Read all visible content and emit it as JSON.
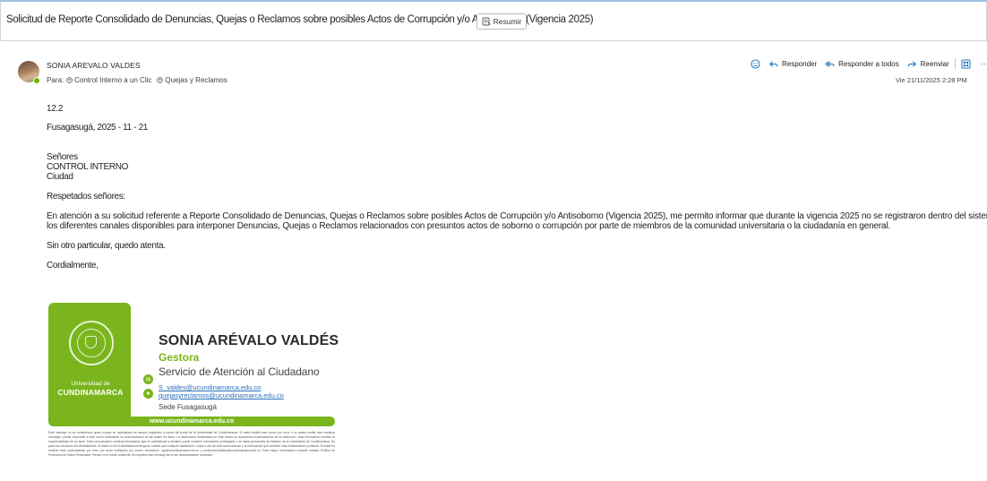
{
  "subject": "Solicitud de Reporte Consolidado de Denuncias, Quejas o Reclamos sobre posibles Actos de Corrupción y/o Antisoborno (Vigencia 2025)",
  "summarize_label": "Resumir",
  "sender": {
    "name": "SONIA AREVALO VALDES",
    "presence": "available"
  },
  "recipients": {
    "label": "Para:",
    "items": [
      "Control Interno a un Clic",
      "Quejas y Reclamos"
    ]
  },
  "actions": {
    "reply": "Responder",
    "reply_all": "Responder a todos",
    "forward": "Reenviar"
  },
  "date": "Vie 21/11/2025 2:28 PM",
  "body": {
    "ref": "12.2",
    "place_date": "Fusagasugá, 2025 - 11 - 21",
    "addressee": [
      "Señores",
      "CONTROL INTERNO",
      "Ciudad"
    ],
    "greeting": "Respetados señores:",
    "paragraph_line1": "En atención a su solicitud referente a Reporte Consolidado de Denuncias, Quejas o Reclamos sobre posibles Actos de Corrupción y/o Antisoborno (Vigencia 2025),  me permito informar que durante la vigencia 2025 no se registraron dentro del sistemas  SAIC y",
    "paragraph_line2": "los diferentes canales disponibles para interponer Denuncias, Quejas o Reclamos relacionados con presuntos actos de soborno o corrupción por parte de miembros de la comunidad universitaria o la ciudadanía en general.",
    "closing": "Sin otro particular, quedo atenta.",
    "sign_off": "Cordialmente,"
  },
  "signature": {
    "university_small": "Universidad de",
    "university_big": "CUNDINAMARCA",
    "name": "SONIA ARÉVALO VALDÉS",
    "role": "Gestora",
    "department": "Servicio de Atención  al Ciudadano",
    "email1": "S_valdes@ucundinamarca.edu.co",
    "email2": "quejasyreclamos@ucundinamarca.edu.co",
    "campus": "Sede Fusagasugá",
    "website": "www.ucundinamarca.edu.co",
    "disclaimer": "Este mensaje no es considerado spam porque su destinatario es usuario registrado a través del portal de la Universidad de Cundinamarca. Si usted recibió este correo por error o no quiere recibir más nuestros mensajes, puede responder a este correo solicitando su desvinculación de las bases de datos. La información transmitida por este medio no representa el pensamiento de la institución; cada información emitida es responsabilidad de su autor. Esta comunicación contiene información que es confidencial y también puede contener información privilegiada o de datos personales de titulares de la Universidad de Cundinamarca. Es para uso exclusivo del destinatario/a. Si usted no es el destinatario/a tenga en cuenta que cualquier distribución, copia o uso de esta comunicación o la información que contiene está estrictamente prohibida. Si usted ha recibido esta comunicación por error por favor notifíquelo por correo electrónico: sgc@ucundinamarca.edu.co y protecciondedatos@ucundinamarca.edu.co. Para mayor información consulte nuestra Política de Protección de Datos Personales. Piense en el medio ambiente: No imprima este mensaje de no ser absolutamente necesario."
  },
  "colors": {
    "brand_green": "#7ab51d",
    "accent_blue": "#0f6cbd",
    "link": "#2a6ebb"
  }
}
